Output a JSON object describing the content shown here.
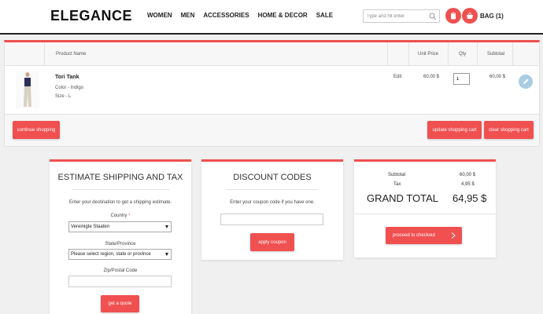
{
  "header": {
    "logo": "ELEGANCE",
    "nav": [
      "WOMEN",
      "MEN",
      "ACCESSORIES",
      "HOME & DECOR",
      "SALE"
    ],
    "search_placeholder": "Type and hit enter",
    "bag_label": "BAG (1)"
  },
  "cart": {
    "columns": {
      "product": "Product Name",
      "unit_price": "Unit Price",
      "qty": "Qty",
      "subtotal": "Subtotal"
    },
    "item": {
      "name": "Tori Tank",
      "color": "Color - Indigo",
      "size": "Size - L",
      "edit": "Edit",
      "unit_price": "60,00 $",
      "qty": "1",
      "subtotal": "60,00 $"
    },
    "continue_label": "continue shopping",
    "update_label": "update shopping cart",
    "clear_label": "clear shopping cart"
  },
  "shipping": {
    "title": "ESTIMATE SHIPPING AND TAX",
    "intro": "Enter your destination to get a shipping estimate.",
    "country_label": "Country",
    "required_mark": "*",
    "country_value": "Vereinigte Staaten",
    "state_label": "State/Province",
    "state_value": "Please select region, state or province",
    "zip_label": "Zip/Postal Code",
    "quote_label": "get a quote"
  },
  "discount": {
    "title": "DISCOUNT CODES",
    "intro": "Enter your coupon code if you have one.",
    "apply_label": "apply coupon"
  },
  "totals": {
    "subtotal_label": "Subtotal",
    "subtotal_value": "60,00 $",
    "tax_label": "Tax",
    "tax_value": "4,95 $",
    "grand_label": "GRAND TOTAL",
    "grand_value": "64,95 $",
    "checkout_label": "proceed to checkout"
  },
  "colors": {
    "accent": "#f05050",
    "remove": "#a9cde3",
    "dark": "#222222"
  }
}
